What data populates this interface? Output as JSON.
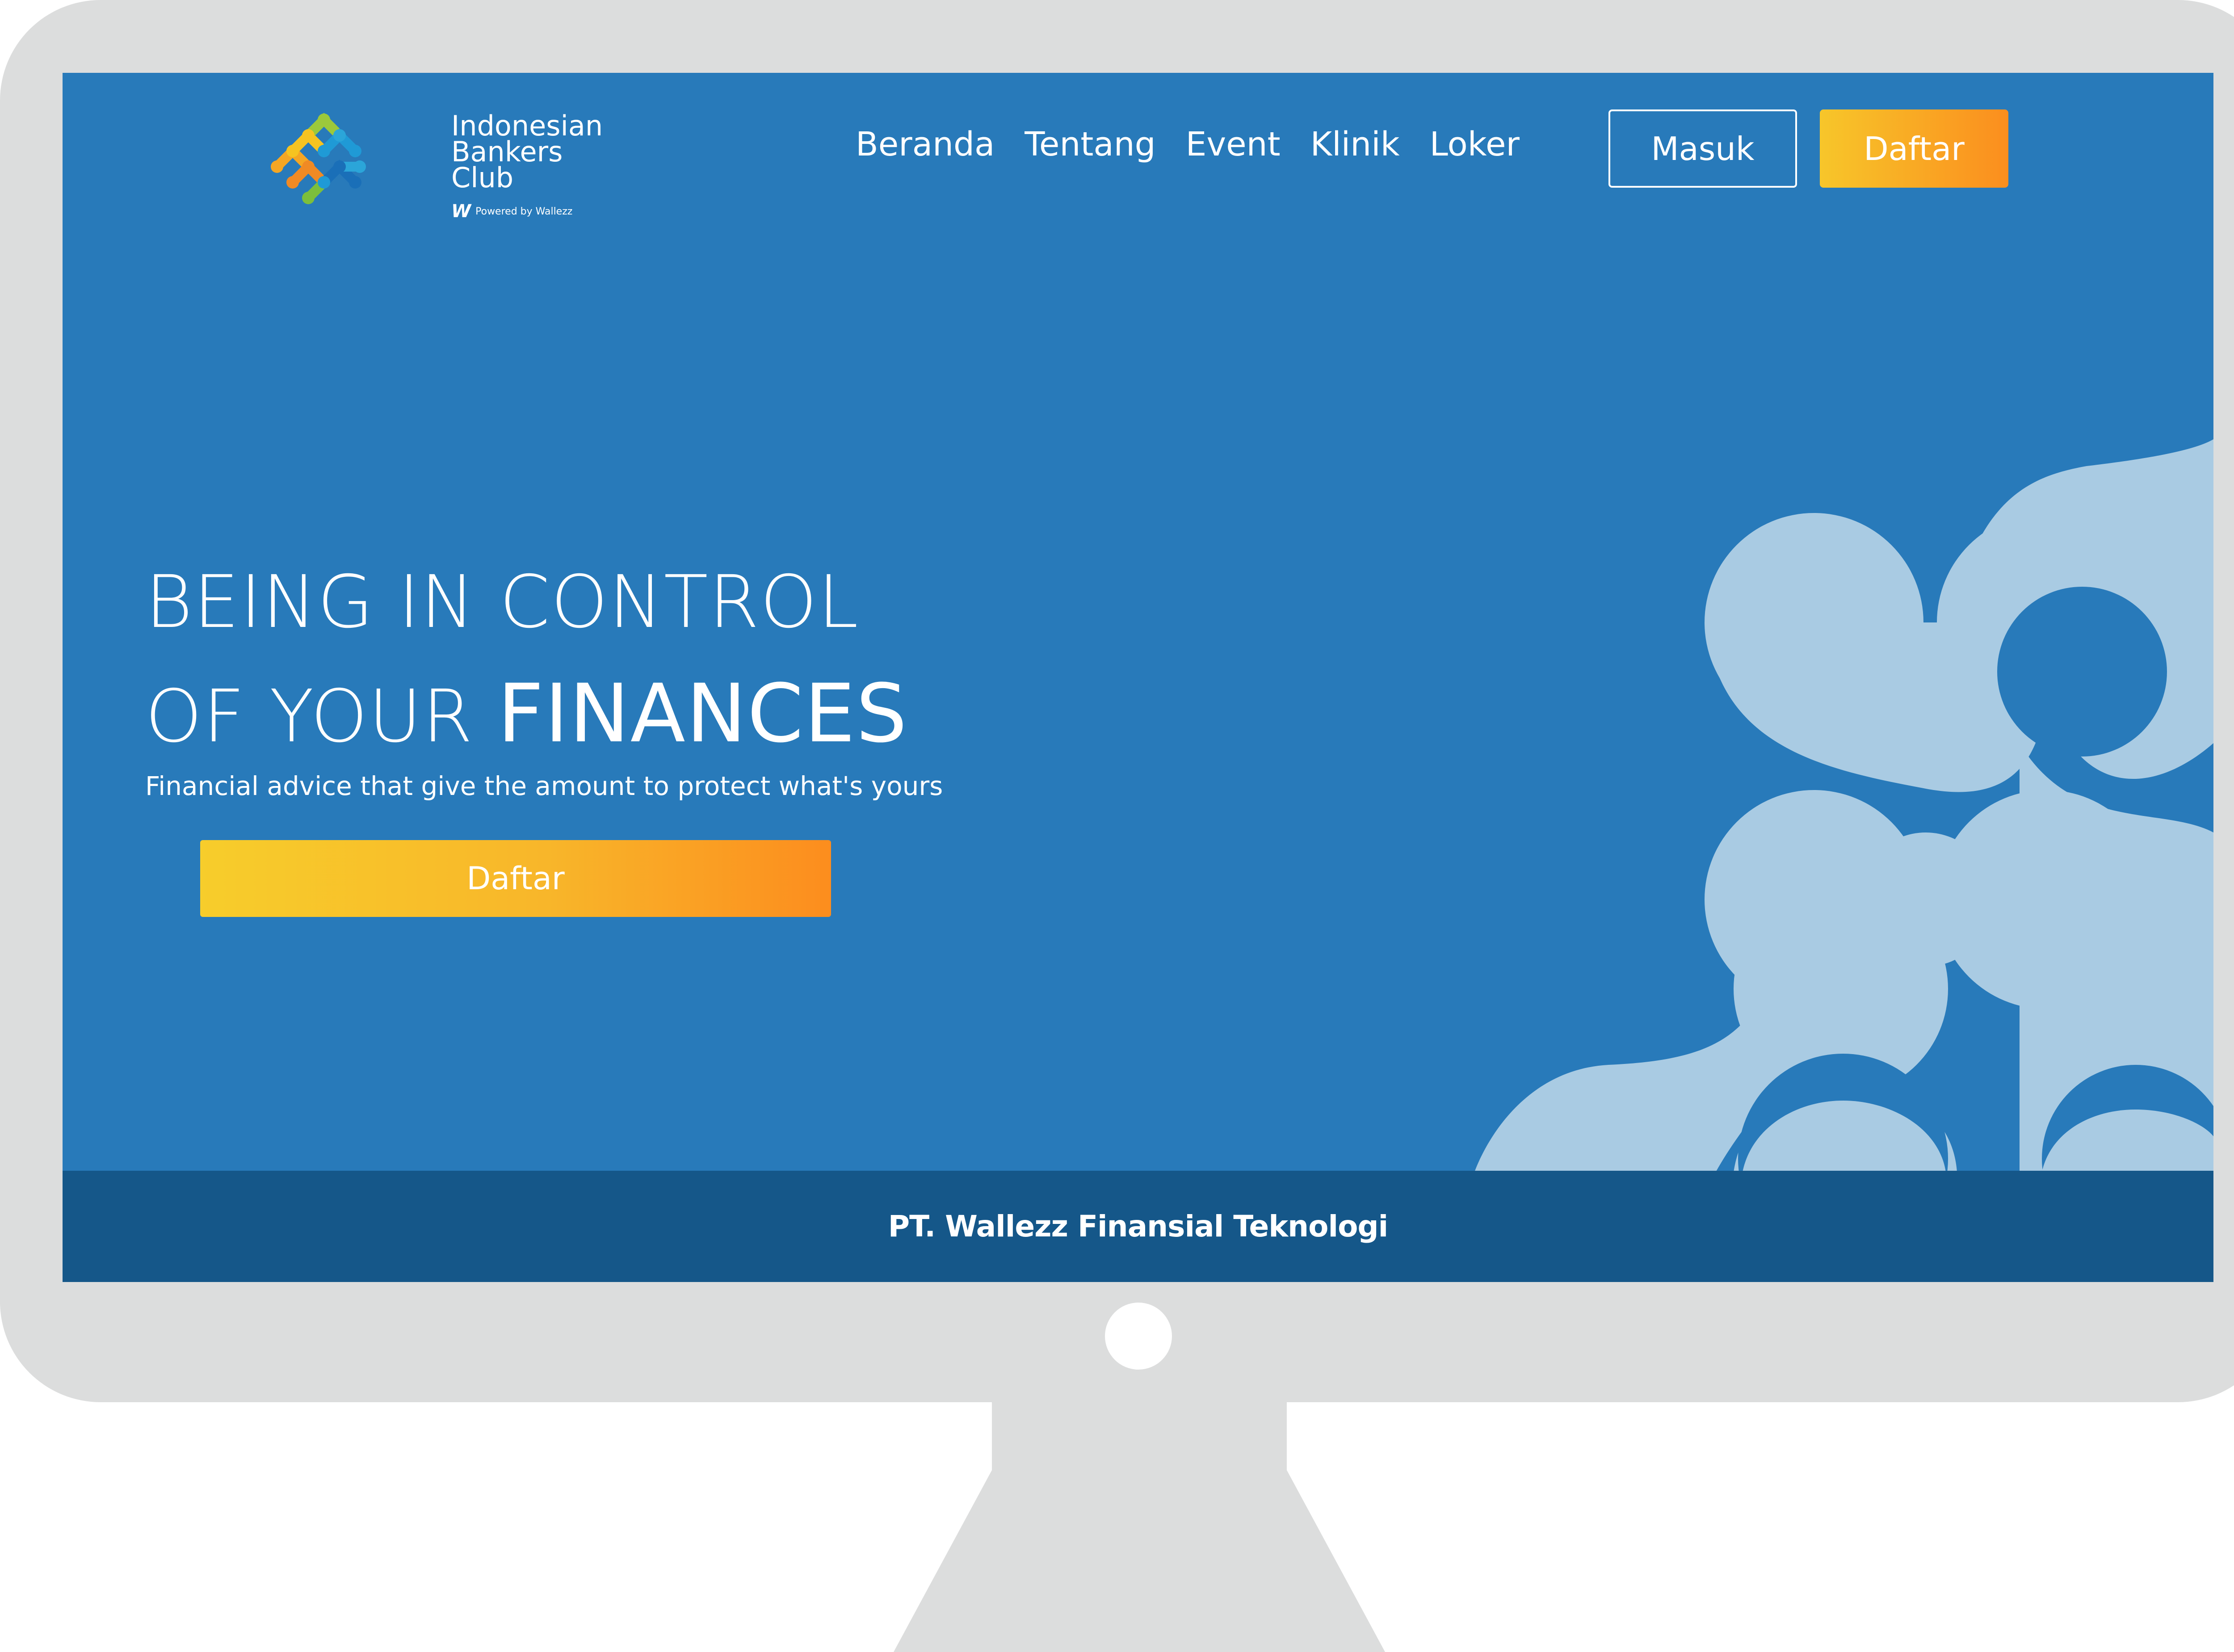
{
  "logo": {
    "lines": [
      "Indonesian",
      "Bankers",
      "Club"
    ],
    "powered_by": "Powered by Wallezz",
    "powered_mark": "W"
  },
  "nav": {
    "items": [
      {
        "label": "Beranda"
      },
      {
        "label": "Tentang"
      },
      {
        "label": "Event"
      },
      {
        "label": "Klinik"
      },
      {
        "label": "Loker"
      }
    ]
  },
  "header": {
    "login_label": "Masuk",
    "register_label": "Daftar"
  },
  "hero": {
    "title_line1": "BEING IN CONTROL",
    "title_line2_light": "OF YOUR ",
    "title_line2_bold": "FINANCES",
    "subtitle": "Financial advice that give the amount to protect what's yours",
    "cta_label": "Daftar"
  },
  "footer": {
    "company": "PT. Wallezz Finansial Teknologi"
  },
  "colors": {
    "brand_blue": "#287aba",
    "footer_blue": "#155789",
    "accent_orange": "#fb8e1e",
    "accent_yellow": "#f7c62a",
    "decor_light_blue": "#a9cbe3"
  }
}
